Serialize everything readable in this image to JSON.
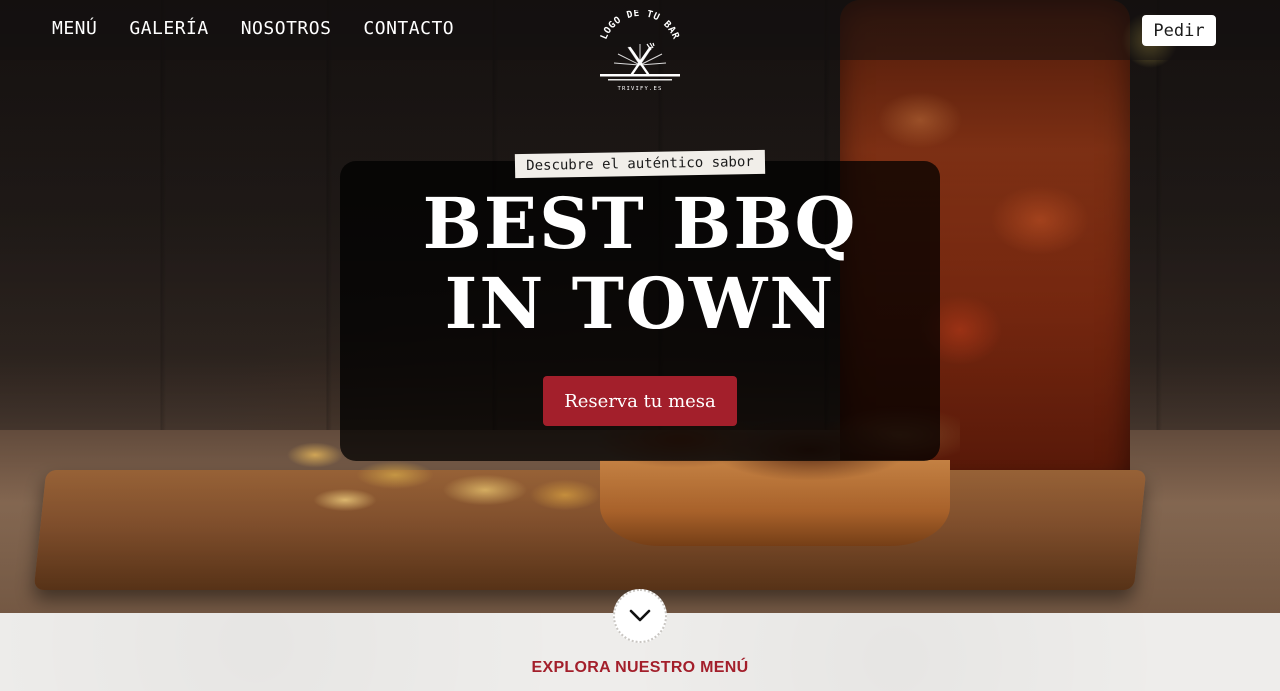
{
  "nav": {
    "items": [
      {
        "label": "MENÚ"
      },
      {
        "label": "GALERÍA"
      },
      {
        "label": "NOSOTROS"
      },
      {
        "label": "CONTACTO"
      }
    ]
  },
  "logo": {
    "text": "LOGO DE TU BAR",
    "subtext": "TRIVIFY.ES",
    "icon": "fork-knife-icon"
  },
  "header": {
    "order_label": "Pedir"
  },
  "hero": {
    "tagline": "Descubre el auténtico sabor",
    "headline_line1": "BEST BBQ",
    "headline_line2": "IN TOWN",
    "cta_label": "Reserva tu mesa"
  },
  "lower": {
    "scroll_icon": "chevron-down-icon",
    "explore_label": "EXPLORA NUESTRO MENÚ"
  },
  "colors": {
    "accent": "#a31f2b",
    "nav_text": "#ffffff",
    "lower_bg": "#eeedeb"
  }
}
